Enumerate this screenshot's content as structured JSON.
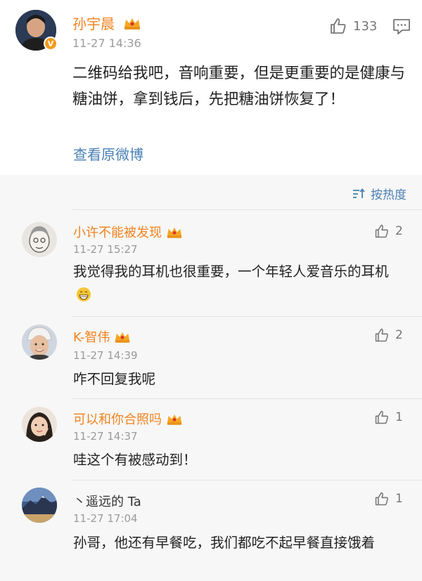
{
  "main_post": {
    "author": "孙宇晨",
    "time": "11-27 14:36",
    "like_count": "133",
    "verified_mark": "V",
    "text": "二维码给我吧，音响重要，但是更重要的是健康与糖油饼，拿到钱后，先把糖油饼恢复了！",
    "view_original": "查看原微博"
  },
  "sort": {
    "label": "按热度",
    "icon": "sort-icon"
  },
  "comments": [
    {
      "author": "小许不能被发现",
      "vip": true,
      "time": "11-27 15:27",
      "likes": "2",
      "text": "我觉得我的耳机也很重要，一个年轻人爱音乐的耳机"
    },
    {
      "author": "K-智伟",
      "vip": true,
      "time": "11-27 14:39",
      "likes": "2",
      "text": "咋不回复我呢"
    },
    {
      "author": "可以和你合照吗",
      "vip": true,
      "time": "11-27 14:37",
      "likes": "1",
      "text": "哇这个有被感动到！"
    },
    {
      "author": "丶遥远的 Ta",
      "vip": false,
      "time": "11-27 17:04",
      "likes": "1",
      "text": "孙哥，他还有早餐吃，我们都吃不起早餐直接饿着"
    }
  ],
  "colors": {
    "name": "#f0821e",
    "link": "#4a7fb4",
    "meta": "#9b9b9b",
    "crown": "#f5a623"
  }
}
